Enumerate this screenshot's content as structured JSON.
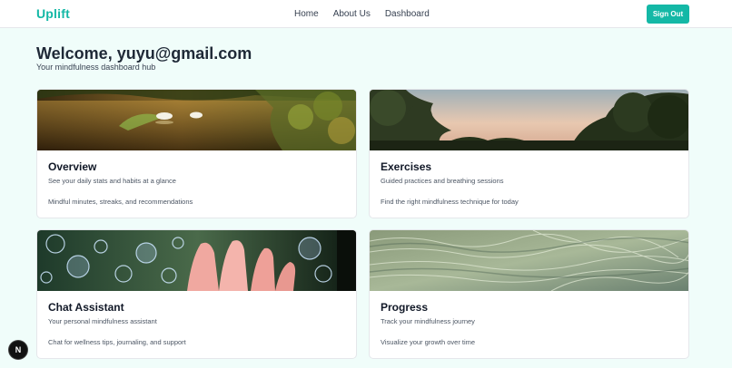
{
  "nav": {
    "brand": "Uplift",
    "links": [
      "Home",
      "About Us",
      "Dashboard"
    ],
    "sign_out": "Sign Out"
  },
  "welcome": {
    "title": "Welcome, yuyu@gmail.com",
    "subtitle": "Your mindfulness dashboard hub"
  },
  "cards": [
    {
      "title": "Overview",
      "subtitle": "See your daily stats and habits at a glance",
      "description": "Mindful minutes, streaks, and recommendations",
      "image": "swans-on-pond"
    },
    {
      "title": "Exercises",
      "subtitle": "Guided practices and breathing sessions",
      "description": "Find the right mindfulness technique for today",
      "image": "trees-at-sunset"
    },
    {
      "title": "Chat Assistant",
      "subtitle": "Your personal mindfulness assistant",
      "description": "Chat for wellness tips, journaling, and support",
      "image": "hand-with-bubbles"
    },
    {
      "title": "Progress",
      "subtitle": "Track your mindfulness journey",
      "description": "Visualize your growth over time",
      "image": "water-ripples-on-sand"
    }
  ],
  "dev_badge": {
    "letter": "N",
    "icon": "nextjs-icon"
  },
  "colors": {
    "brand": "#14b8a6",
    "background": "#f0fdfa",
    "card": "#ffffff"
  }
}
